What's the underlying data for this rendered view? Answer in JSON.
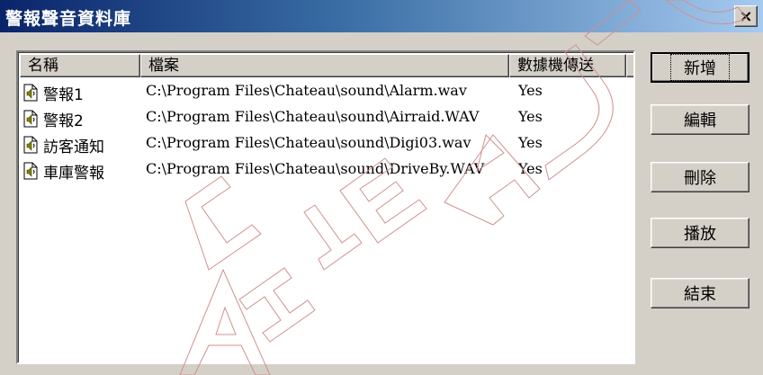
{
  "window": {
    "title": "警報聲音資料庫",
    "close_label": "×"
  },
  "list": {
    "columns": [
      "名稱",
      "檔案",
      "數據機傳送"
    ],
    "rows": [
      {
        "name": "警報1",
        "file": "C:\\Program Files\\Chateau\\sound\\Alarm.wav",
        "send": "Yes"
      },
      {
        "name": "警報2",
        "file": "C:\\Program Files\\Chateau\\sound\\Airraid.WAV",
        "send": "Yes"
      },
      {
        "name": "訪客通知",
        "file": "C:\\Program Files\\Chateau\\sound\\Digi03.wav",
        "send": "Yes"
      },
      {
        "name": "車庫警報",
        "file": "C:\\Program Files\\Chateau\\sound\\DriveBy.WAV",
        "send": "Yes"
      }
    ]
  },
  "buttons": {
    "add": "新增",
    "edit": "編輯",
    "delete": "刪除",
    "play": "播放",
    "close": "結束"
  },
  "watermark": {
    "text": "CHATEAU"
  }
}
